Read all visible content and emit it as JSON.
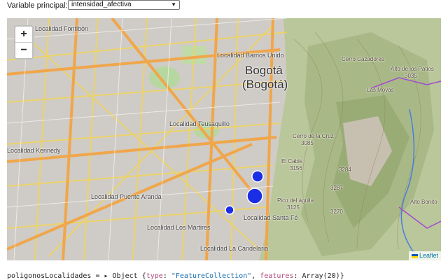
{
  "control": {
    "label": "Variable principal:",
    "selected": "intensidad_afectiva"
  },
  "map": {
    "zoom_in": "+",
    "zoom_out": "−",
    "labels": {
      "fontibon": "Localidad Fontibón",
      "barrios_unidos": "Localidad Barrios Unido",
      "bogota": "Bogotá",
      "bogota_paren": "(Bogotá)",
      "teusaquillo": "Localidad Teusaquillo",
      "kennedy": "Localidad Kennedy",
      "puente_aranda": "Localidad Puente Aranda",
      "los_martires": "Localidad Los Mártires",
      "santa_fe": "Localidad Santa Fé",
      "candelaria": "Localidad La Candelaria",
      "cerro_cazadores": "Cerro Cazadores",
      "alto_patios": "Alto de los Patios",
      "alto_patios_elev": "3035",
      "las_moyas": "Las Moyas",
      "cerro_cruz": "Cerro de la Cruz",
      "cerro_cruz_elev": "3085",
      "el_cable": "El Cable",
      "el_cable_elev": "3156",
      "pico_aguila": "Pico del águila",
      "pico_aguila_elev": "3125",
      "elev_3284": "3284",
      "elev_3287": "3287",
      "elev_3270": "3270",
      "alto_bonito": "Alto Bonito"
    },
    "markers": [
      {
        "name": "marker-1",
        "value": "medium"
      },
      {
        "name": "marker-2",
        "value": "large"
      },
      {
        "name": "marker-3",
        "value": "small"
      }
    ],
    "marker_color": "#1a2ee6",
    "attribution": "Leaflet"
  },
  "code": {
    "variable": "poligonosLocalidades",
    "equals": " = ",
    "toggle": "▸ ",
    "object_word": "Object ",
    "open": "{",
    "key_type": "type",
    "colon1": ": ",
    "val_type": "\"FeatureCollection\"",
    "comma": ", ",
    "key_features": "features",
    "colon2": ": ",
    "val_features": "Array(20)",
    "close": "}"
  }
}
